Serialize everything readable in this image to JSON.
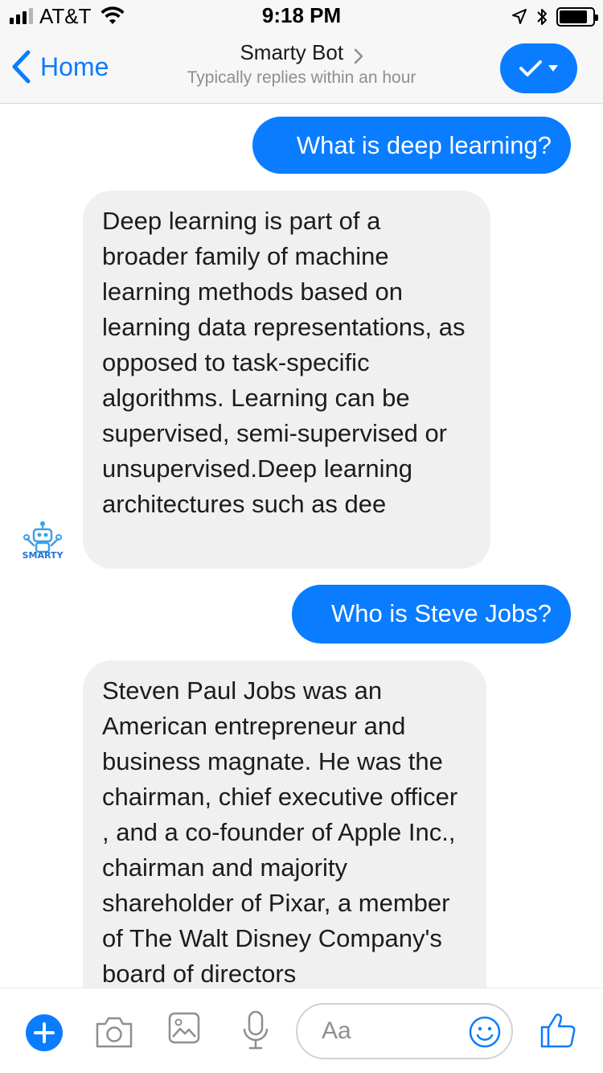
{
  "status_bar": {
    "carrier": "AT&T",
    "time": "9:18 PM",
    "signal_bars_filled": 3,
    "signal_bars_total": 4
  },
  "nav": {
    "back_label": "Home",
    "title": "Smarty Bot",
    "subtitle": "Typically replies within an hour",
    "accent_color": "#0a7cff"
  },
  "messages": [
    {
      "direction": "outgoing",
      "text": "What is deep learning?"
    },
    {
      "direction": "incoming",
      "text": "Deep learning  is part of a broader family of machine learning methods based on learning data representations, as opposed to task-specific algorithms. Learning can be supervised, semi-supervised or unsupervised.Deep learning architectures such as dee"
    },
    {
      "direction": "outgoing",
      "text": "Who is Steve Jobs?"
    },
    {
      "direction": "incoming",
      "text": "Steven Paul Jobs  was an American entrepreneur and business magnate. He was the chairman, chief executive officer , and a co-founder of Apple Inc., chairman and majority shareholder of Pixar, a member of The Walt Disney Company's board of directors"
    }
  ],
  "bot": {
    "avatar_label": "SMARTY"
  },
  "composer": {
    "placeholder": "Aa"
  },
  "icons": [
    "signal-icon",
    "wifi-icon",
    "location-icon",
    "bluetooth-icon",
    "battery-icon",
    "back-chevron-icon",
    "chevron-right-icon",
    "checkmark-icon",
    "dropdown-arrow-icon",
    "robot-avatar-icon",
    "plus-icon",
    "camera-icon",
    "image-icon",
    "microphone-icon",
    "emoji-icon",
    "thumbs-up-icon"
  ]
}
